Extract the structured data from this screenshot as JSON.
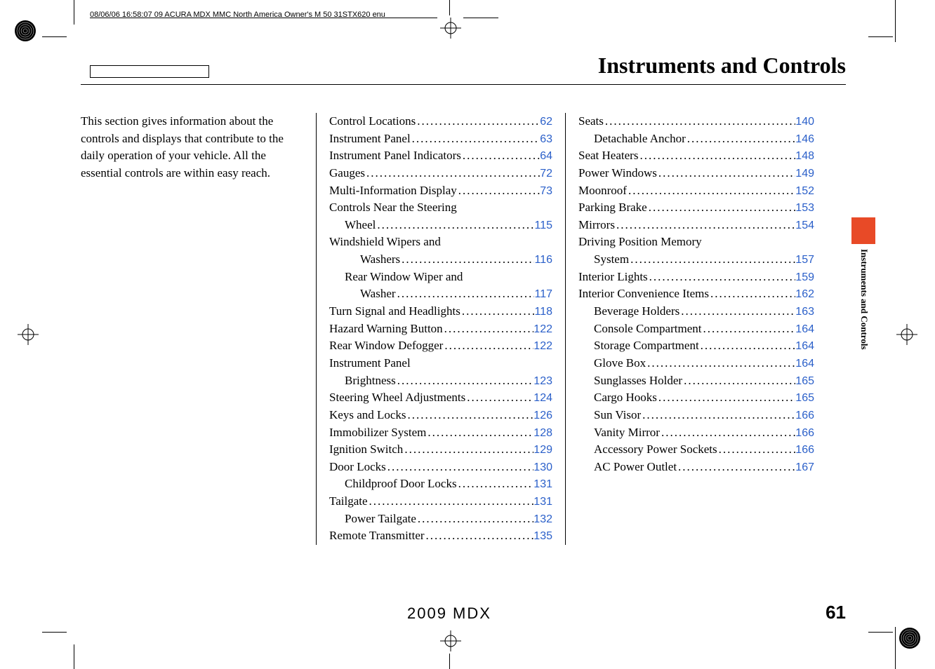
{
  "header_stamp": "08/06/06 16:58:07    09 ACURA MDX MMC North America Owner's M 50 31STX620 enu",
  "section_title": "Instruments and Controls",
  "intro": "This section gives information about the controls and displays that contribute to the daily operation of your vehicle. All the essential controls are within easy reach.",
  "col2": [
    {
      "label": "Control Locations",
      "page": "62",
      "indent": 0
    },
    {
      "label": "Instrument Panel",
      "page": "63",
      "indent": 0
    },
    {
      "label": "Instrument Panel Indicators",
      "page": "64",
      "indent": 0
    },
    {
      "label": "Gauges",
      "page": "72",
      "indent": 0
    },
    {
      "label": "Multi-Information Display",
      "page": "73",
      "indent": 0
    },
    {
      "label": "Controls Near the Steering",
      "indent": 0,
      "cont": true
    },
    {
      "label": "Wheel",
      "page": "115",
      "indent": 1
    },
    {
      "label": "Windshield Wipers and",
      "indent": 0,
      "cont": true
    },
    {
      "label": "Washers",
      "page": "116",
      "indent": 2
    },
    {
      "label": "Rear Window Wiper and",
      "indent": 1,
      "cont": true
    },
    {
      "label": "Washer",
      "page": "117",
      "indent": 2
    },
    {
      "label": "Turn Signal and Headlights",
      "page": "118",
      "indent": 0
    },
    {
      "label": "Hazard Warning Button",
      "page": "122",
      "indent": 0
    },
    {
      "label": "Rear Window Defogger",
      "page": "122",
      "indent": 0
    },
    {
      "label": "Instrument Panel",
      "indent": 0,
      "cont": true
    },
    {
      "label": "Brightness",
      "page": "123",
      "indent": 1
    },
    {
      "label": "Steering Wheel Adjustments",
      "page": "124",
      "indent": 0
    },
    {
      "label": "Keys and Locks",
      "page": "126",
      "indent": 0
    },
    {
      "label": "Immobilizer System",
      "page": "128",
      "indent": 0
    },
    {
      "label": "Ignition Switch",
      "page": "129",
      "indent": 0
    },
    {
      "label": "Door Locks",
      "page": "130",
      "indent": 0
    },
    {
      "label": "Childproof Door Locks",
      "page": "131",
      "indent": 1
    },
    {
      "label": "Tailgate",
      "page": "131",
      "indent": 0
    },
    {
      "label": "Power Tailgate",
      "page": "132",
      "indent": 1
    },
    {
      "label": "Remote Transmitter",
      "page": "135",
      "indent": 0
    }
  ],
  "col3": [
    {
      "label": "Seats",
      "page": "140",
      "indent": 0
    },
    {
      "label": "Detachable Anchor",
      "page": "146",
      "indent": 1
    },
    {
      "label": "Seat Heaters",
      "page": "148",
      "indent": 0
    },
    {
      "label": "Power Windows",
      "page": "149",
      "indent": 0
    },
    {
      "label": "Moonroof",
      "page": "152",
      "indent": 0
    },
    {
      "label": "Parking Brake",
      "page": "153",
      "indent": 0
    },
    {
      "label": "Mirrors",
      "page": "154",
      "indent": 0
    },
    {
      "label": "Driving Position Memory",
      "indent": 0,
      "cont": true
    },
    {
      "label": "System",
      "page": "157",
      "indent": 1
    },
    {
      "label": "Interior Lights",
      "page": "159",
      "indent": 0
    },
    {
      "label": "Interior Convenience Items",
      "page": "162",
      "indent": 0
    },
    {
      "label": "Beverage Holders",
      "page": "163",
      "indent": 1
    },
    {
      "label": "Console Compartment",
      "page": "164",
      "indent": 1
    },
    {
      "label": "Storage Compartment",
      "page": "164",
      "indent": 1
    },
    {
      "label": "Glove Box",
      "page": "164",
      "indent": 1
    },
    {
      "label": "Sunglasses Holder",
      "page": "165",
      "indent": 1
    },
    {
      "label": "Cargo Hooks",
      "page": "165",
      "indent": 1
    },
    {
      "label": "Sun Visor",
      "page": "166",
      "indent": 1
    },
    {
      "label": "Vanity Mirror",
      "page": "166",
      "indent": 1
    },
    {
      "label": "Accessory Power Sockets",
      "page": "166",
      "indent": 1
    },
    {
      "label": "AC Power Outlet",
      "page": "167",
      "indent": 1
    }
  ],
  "side_label": "Instruments and Controls",
  "footer_model": "2009  MDX",
  "footer_page": "61"
}
